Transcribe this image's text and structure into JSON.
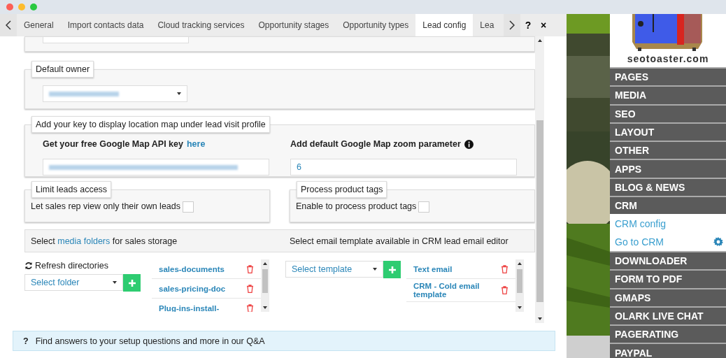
{
  "tabs": [
    {
      "label": "General",
      "selected": false
    },
    {
      "label": "Import contacts data",
      "selected": false
    },
    {
      "label": "Cloud tracking services",
      "selected": false
    },
    {
      "label": "Opportunity stages",
      "selected": false
    },
    {
      "label": "Opportunity types",
      "selected": false
    },
    {
      "label": "Lead config",
      "selected": true
    },
    {
      "label": "Lea",
      "selected": false
    }
  ],
  "help_button": "?",
  "close_button": "×",
  "default_owner": {
    "legend": "Default owner"
  },
  "map_section": {
    "legend": "Add your key to display location map under lead visit profile",
    "api_key_label": "Get your free Google Map API key",
    "api_key_link": "here",
    "zoom_label": "Add default Google Map zoom parameter",
    "zoom_value": "6"
  },
  "limit_leads": {
    "legend": "Limit leads access",
    "label": "Let sales rep view only their own leads",
    "checked": false
  },
  "product_tags": {
    "legend": "Process product tags",
    "label": "Enable to process product tags",
    "checked": false
  },
  "media_text": {
    "before": "Select",
    "link": "media folders",
    "after": "for sales storage"
  },
  "email_text": "Select email template available in CRM lead email editor",
  "refresh": "Refresh directories",
  "folder_select": "Select folder",
  "folders": [
    "sales-documents",
    "sales-pricing-doc",
    "Plug-ins-install-"
  ],
  "template_select": "Select template",
  "templates": [
    "Text email",
    "CRM - Cold email template"
  ],
  "help_bar": {
    "icon": "?",
    "text": "Find answers to your setup questions and more in our Q&A"
  },
  "sidebar": {
    "logo_text": "seotoaster.com",
    "items": [
      {
        "label": "PAGES",
        "kind": "section"
      },
      {
        "label": "MEDIA",
        "kind": "section"
      },
      {
        "label": "SEO",
        "kind": "section"
      },
      {
        "label": "LAYOUT",
        "kind": "section"
      },
      {
        "label": "OTHER",
        "kind": "section"
      },
      {
        "label": "APPS",
        "kind": "section"
      },
      {
        "label": "BLOG & NEWS",
        "kind": "section"
      },
      {
        "label": "CRM",
        "kind": "section"
      },
      {
        "label": "CRM config",
        "kind": "link"
      },
      {
        "label": "Go to CRM",
        "kind": "link-settings"
      },
      {
        "label": "DOWNLOADER",
        "kind": "section"
      },
      {
        "label": "FORM TO PDF",
        "kind": "section"
      },
      {
        "label": "GMAPS",
        "kind": "section"
      },
      {
        "label": "OLARK LIVE CHAT",
        "kind": "section"
      },
      {
        "label": "PAGERATING",
        "kind": "section"
      },
      {
        "label": "PAYPAL",
        "kind": "section"
      }
    ]
  }
}
